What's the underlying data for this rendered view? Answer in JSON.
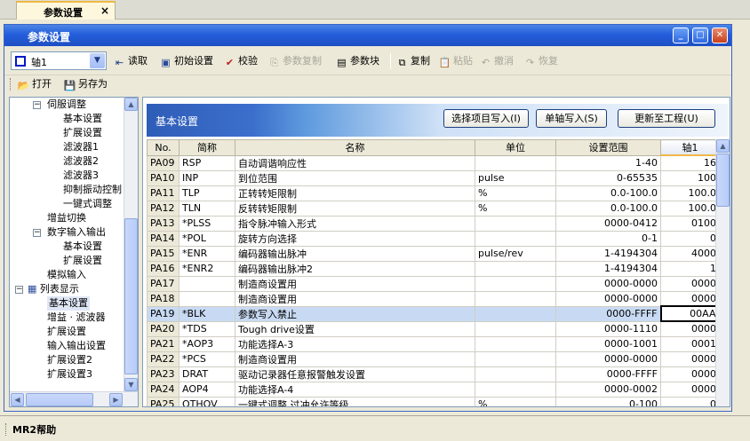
{
  "doc_tab": {
    "label": "参数设置",
    "close": "×"
  },
  "window": {
    "title": "参数设置",
    "min": "_",
    "max": "□",
    "close": "✕"
  },
  "toolbar": {
    "axis_value": "轴1",
    "read": "读取",
    "init": "初始设置",
    "verify": "校验",
    "param_copy": "参数复制",
    "param_block": "参数块",
    "copy": "复制",
    "paste": "粘贴",
    "undo": "撤消",
    "redo": "恢复"
  },
  "toolbar2": {
    "open": "打开",
    "save_as": "另存为"
  },
  "tree": {
    "servo": "伺服调整",
    "basic": "基本设置",
    "ext": "扩展设置",
    "filter1": "滤波器1",
    "filter2": "滤波器2",
    "filter3": "滤波器3",
    "vib": "抑制振动控制",
    "onetouch": "一键式调整",
    "gain": "增益切换",
    "dio": "数字输入输出",
    "dio_basic": "基本设置",
    "dio_ext": "扩展设置",
    "analog": "模拟输入",
    "list": "列表显示",
    "list_basic": "基本设置",
    "list_gain": "增益 · 滤波器",
    "list_ext": "扩展设置",
    "list_io": "输入输出设置",
    "list_ext2": "扩展设置2",
    "list_ext3": "扩展设置3"
  },
  "panel": {
    "title": "基本设置",
    "btn_write_sel": "选择项目写入(I)",
    "btn_write_axis": "单轴写入(S)",
    "btn_update": "更新至工程(U)"
  },
  "table": {
    "headers": [
      "No.",
      "简称",
      "名称",
      "单位",
      "设置范围",
      "轴1"
    ],
    "rows": [
      [
        "PA09",
        "RSP",
        "自动调谐响应性",
        "",
        "1-40",
        "16"
      ],
      [
        "PA10",
        "INP",
        "到位范围",
        "pulse",
        "0-65535",
        "100"
      ],
      [
        "PA11",
        "TLP",
        "正转转矩限制",
        "%",
        "0.0-100.0",
        "100.0"
      ],
      [
        "PA12",
        "TLN",
        "反转转矩限制",
        "%",
        "0.0-100.0",
        "100.0"
      ],
      [
        "PA13",
        "*PLSS",
        "指令脉冲输入形式",
        "",
        "0000-0412",
        "0100"
      ],
      [
        "PA14",
        "*POL",
        "旋转方向选择",
        "",
        "0-1",
        "0"
      ],
      [
        "PA15",
        "*ENR",
        "编码器输出脉冲",
        "pulse/rev",
        "1-4194304",
        "4000"
      ],
      [
        "PA16",
        "*ENR2",
        "编码器输出脉冲2",
        "",
        "1-4194304",
        "1"
      ],
      [
        "PA17",
        "",
        "制造商设置用",
        "",
        "0000-0000",
        "0000"
      ],
      [
        "PA18",
        "",
        "制造商设置用",
        "",
        "0000-0000",
        "0000"
      ],
      [
        "PA19",
        "*BLK",
        "参数写入禁止",
        "",
        "0000-FFFF",
        "00AA"
      ],
      [
        "PA20",
        "*TDS",
        "Tough drive设置",
        "",
        "0000-1110",
        "0000"
      ],
      [
        "PA21",
        "*AOP3",
        "功能选择A-3",
        "",
        "0000-1001",
        "0001"
      ],
      [
        "PA22",
        "*PCS",
        "制造商设置用",
        "",
        "0000-0000",
        "0000"
      ],
      [
        "PA23",
        "DRAT",
        "驱动记录器任意报警触发设置",
        "",
        "0000-FFFF",
        "0000"
      ],
      [
        "PA24",
        "AOP4",
        "功能选择A-4",
        "",
        "0000-0002",
        "0000"
      ],
      [
        "PA25",
        "OTHOV",
        "一键式调整 过冲允许等级",
        "%",
        "0-100",
        "0"
      ]
    ]
  },
  "bottom": {
    "help": "MR2帮助"
  }
}
